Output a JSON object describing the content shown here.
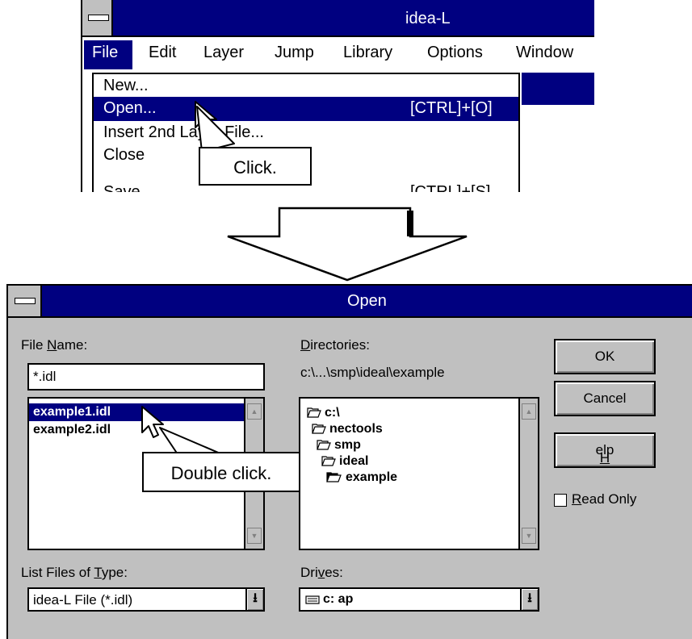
{
  "app": {
    "title": "idea-L",
    "menu": [
      "File",
      "Edit",
      "Layer",
      "Jump",
      "Library",
      "Options",
      "Window"
    ],
    "file_menu": {
      "items": [
        {
          "label": "New...",
          "shortcut": ""
        },
        {
          "label": "Open...",
          "shortcut": "[CTRL]+[O]"
        },
        {
          "label": "Insert 2nd Layer File...",
          "shortcut": ""
        },
        {
          "label": "Close",
          "shortcut": ""
        },
        {
          "label": "Save",
          "shortcut": "[CTRL]+[S]"
        }
      ],
      "selected": "Open..."
    }
  },
  "callouts": {
    "click": "Click.",
    "double_click": "Double click."
  },
  "dialog": {
    "title": "Open",
    "file_name_label": "File Name:",
    "file_name_value": "*.idl",
    "files": [
      "example1.idl",
      "example2.idl"
    ],
    "selected_file": "example1.idl",
    "directories_label": "Directories:",
    "current_directory": "c:\\...\\smp\\ideal\\example",
    "directories": [
      {
        "name": "c:\\",
        "icon": "open-folder-icon"
      },
      {
        "name": "nectools",
        "icon": "open-folder-icon"
      },
      {
        "name": "smp",
        "icon": "open-folder-icon"
      },
      {
        "name": "ideal",
        "icon": "open-folder-icon"
      },
      {
        "name": "example",
        "icon": "open-folder-selected-icon"
      }
    ],
    "list_type_label": "List Files of Type:",
    "list_type_value": "idea-L File (*.idl)",
    "drives_label": "Drives:",
    "drive_value": "c: ap",
    "buttons": {
      "ok": "OK",
      "cancel": "Cancel",
      "help": "Help"
    },
    "read_only_label": "Read Only",
    "read_only_checked": false
  },
  "colors": {
    "titlebar": "#000080",
    "dialog_face": "#c0c0c0",
    "selection": "#000080"
  }
}
